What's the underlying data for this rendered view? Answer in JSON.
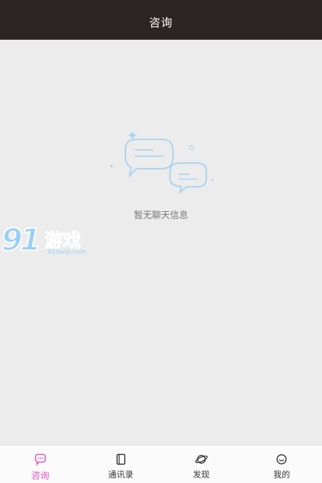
{
  "header": {
    "title": "咨询"
  },
  "main": {
    "empty_message": "暂无聊天信息",
    "empty_illustration_icon": "chat-bubbles-icon"
  },
  "watermark": {
    "number": "91",
    "brand": "游戏",
    "url": "91danji.com"
  },
  "tabbar": {
    "active_color": "#e056c2",
    "items": [
      {
        "label": "咨询",
        "icon": "chat-icon",
        "active": true
      },
      {
        "label": "通讯录",
        "icon": "contacts-icon",
        "active": false
      },
      {
        "label": "发现",
        "icon": "planet-icon",
        "active": false
      },
      {
        "label": "我的",
        "icon": "profile-icon",
        "active": false
      }
    ]
  },
  "colors": {
    "header_bg": "#2d2523",
    "page_bg": "#ececec",
    "illustration": "#a9d3f0"
  }
}
